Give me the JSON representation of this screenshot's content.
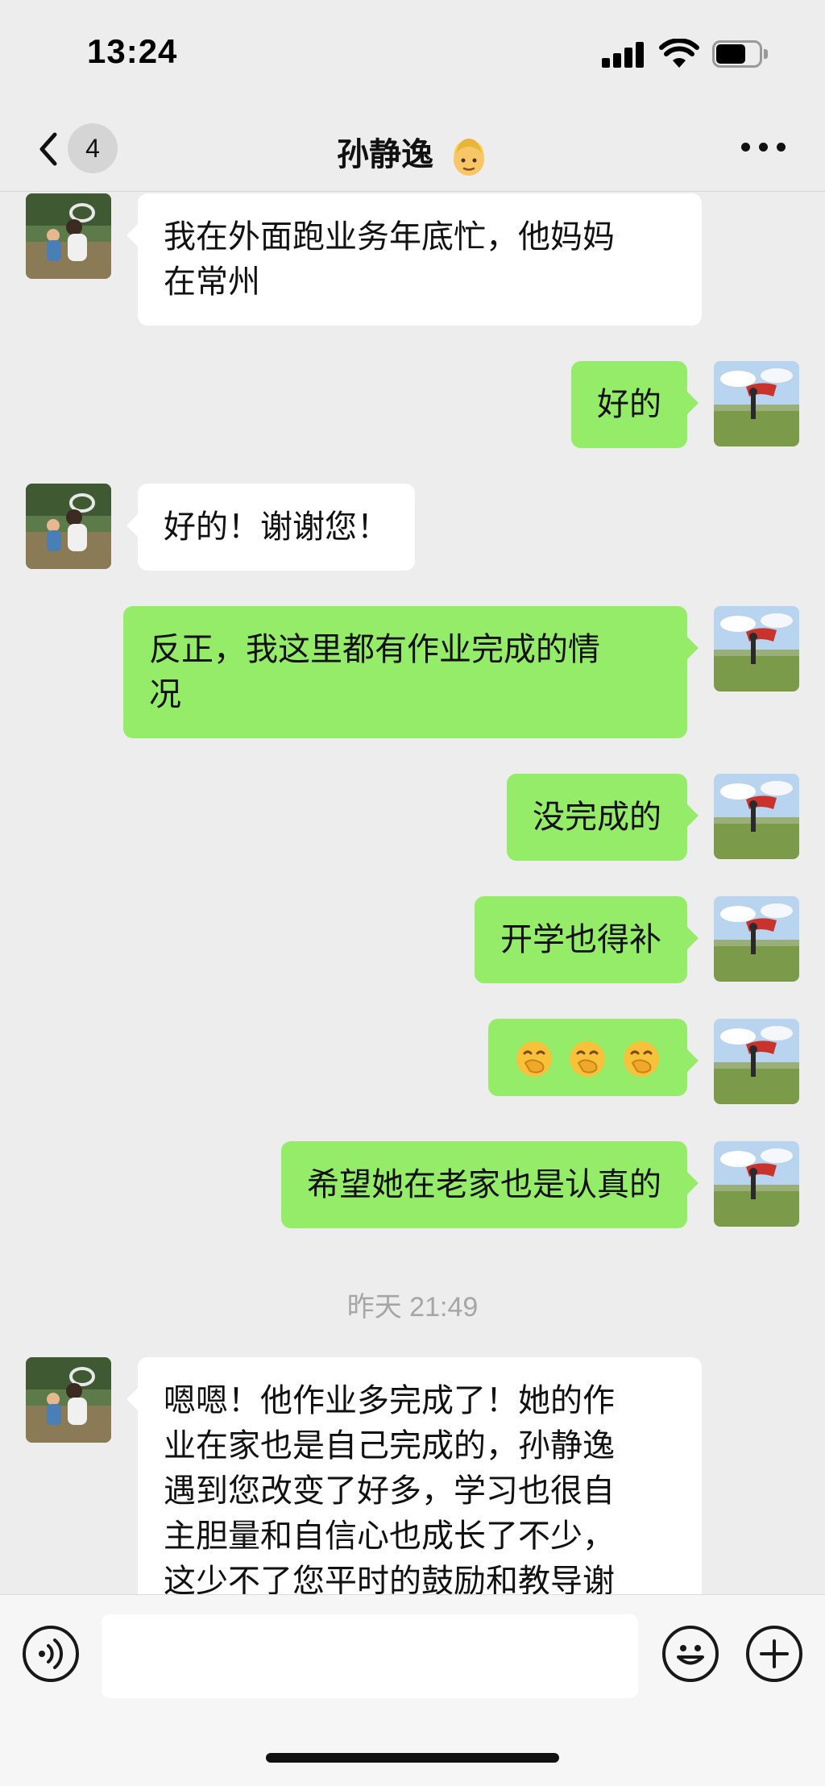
{
  "status_bar": {
    "time": "13:24"
  },
  "header": {
    "unread_count": "4",
    "title": "孙静逸",
    "title_emoji": "man-blond-emoji"
  },
  "messages": [
    {
      "side": "in",
      "text": "我在外面跑业务年底忙，他妈妈\n在常州"
    },
    {
      "side": "out",
      "text": "好的"
    },
    {
      "side": "in",
      "text": "好的！谢谢您！"
    },
    {
      "side": "out",
      "text": "反正，我这里都有作业完成的情\n况"
    },
    {
      "side": "out",
      "text": "没完成的"
    },
    {
      "side": "out",
      "text": "开学也得补"
    },
    {
      "side": "out",
      "text": "",
      "emoji": [
        "hand-over-mouth-emoji",
        "hand-over-mouth-emoji",
        "hand-over-mouth-emoji"
      ]
    },
    {
      "side": "out",
      "text": "希望她在老家也是认真的"
    },
    {
      "timestamp": "昨天 21:49"
    },
    {
      "side": "in",
      "text": "嗯嗯！他作业多完成了！她的作\n业在家也是自己完成的，孙静逸\n遇到您改变了好多，学习也很自\n主胆量和自信心也成长了不少，\n这少不了您平时的鼓励和教导谢"
    }
  ],
  "colors": {
    "background": "#ededed",
    "outgoing_bubble": "#95ec69",
    "incoming_bubble": "#ffffff",
    "timestamp": "#a6a6a6"
  },
  "input_bar": {
    "voice_icon": "voice-icon",
    "emoji_icon": "emoji-icon",
    "plus_icon": "plus-icon",
    "input_value": ""
  }
}
